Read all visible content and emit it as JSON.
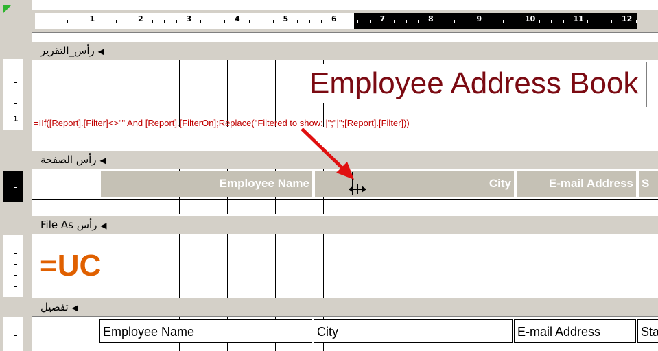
{
  "ruler": {
    "numbers": [
      "1",
      "2",
      "3",
      "4",
      "5",
      "6",
      "7",
      "8",
      "9",
      "10",
      "11",
      "12"
    ]
  },
  "sections": {
    "report_header": "رأس_التقرير",
    "page_header": "رأس الصفحة",
    "file_as_header": "رأس File As",
    "detail": "تفصيل"
  },
  "report_header": {
    "title": "Employee Address Book",
    "filter_expression": "=IIf([Report].[Filter]<>\"\" And [Report].[FilterOn];Replace(\"Filtered to show: |\";\"|\";[Report].[Filter]))"
  },
  "page_header": {
    "col_employee_name": "Employee Name",
    "col_city": "City",
    "col_email": "E-mail Address",
    "col_state": "S"
  },
  "file_as_header": {
    "group_textbox": "=UC"
  },
  "detail": {
    "field_employee_name": "Employee Name",
    "field_city": "City",
    "field_email": "E-mail Address",
    "field_state": "Sta"
  },
  "colors": {
    "title": "#7b0a12",
    "formula": "#c00000",
    "header_fill": "#c5c1b5",
    "group_text": "#e06000",
    "pointer_arrow": "#e01010"
  },
  "icons": [
    "section-collapse-icon",
    "resize-cursor-icon",
    "red-pointer-arrow"
  ]
}
